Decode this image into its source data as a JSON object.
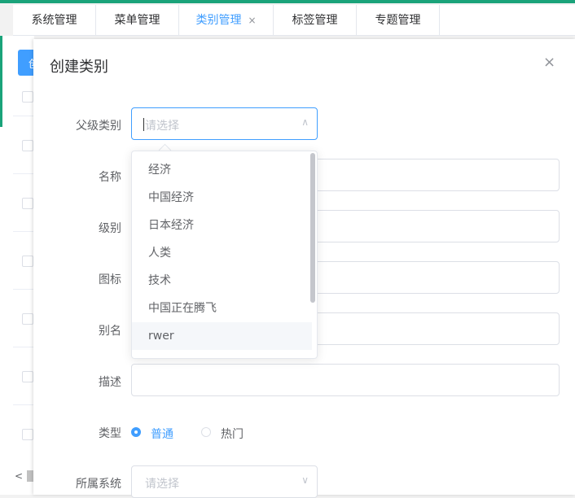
{
  "tabs": [
    {
      "label": "系统管理",
      "active": false
    },
    {
      "label": "菜单管理",
      "active": false
    },
    {
      "label": "类别管理",
      "active": true,
      "close": "×"
    },
    {
      "label": "标签管理",
      "active": false
    },
    {
      "label": "专题管理",
      "active": false
    }
  ],
  "background": {
    "add_button_glyph": "创",
    "scroll_left": "<"
  },
  "dialog": {
    "title": "创建类别",
    "close_icon": "×",
    "fields": {
      "parent": {
        "label": "父级类别",
        "placeholder": "请选择",
        "value": ""
      },
      "name": {
        "label": "名称",
        "value": ""
      },
      "level": {
        "label": "级别",
        "value": ""
      },
      "icon": {
        "label": "图标",
        "value": ""
      },
      "alias": {
        "label": "别名",
        "value": ""
      },
      "description": {
        "label": "描述",
        "value": ""
      },
      "type": {
        "label": "类型",
        "options": [
          "普通",
          "热门"
        ],
        "selected": "普通"
      },
      "system": {
        "label": "所属系统",
        "placeholder": "请选择",
        "value": ""
      }
    },
    "dropdown": {
      "options": [
        "经济",
        "中国经济",
        "日本经济",
        "人类",
        "技术",
        "中国正在腾飞",
        "rwer"
      ],
      "hovered": "rwer"
    }
  },
  "colors": {
    "accent": "#409eff",
    "top_bar": "#1aa37a"
  }
}
